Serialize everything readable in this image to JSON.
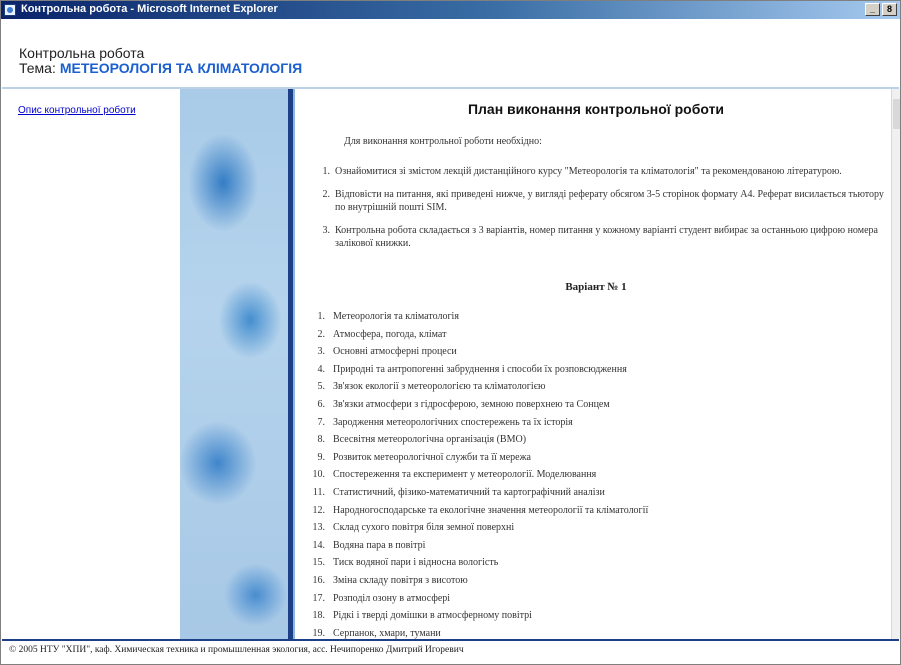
{
  "window": {
    "title": "Контрольна робота - Microsoft Internet Explorer",
    "controls": [
      "_",
      "8"
    ]
  },
  "header": {
    "line1": "Контрольна робота",
    "topic_label": "Тема:",
    "topic": "МЕТЕОРОЛОГІЯ ТА КЛІМАТОЛОГІЯ"
  },
  "sidebar": {
    "link_label": "Опис контрольної роботи"
  },
  "main": {
    "heading": "План виконання контрольної роботи",
    "intro": "Для виконання контрольної роботи необхідно:",
    "requirements": [
      {
        "num": "1.",
        "text": "Ознайомитися зі змістом лекцій дистанційного курсу \"Метеорологія та кліматологія\" та рекомендованою літературою."
      },
      {
        "num": "2.",
        "text": "Відповісти на питання, які приведені нижче, у вигляді реферату обсягом 3-5 сторінок формату А4. Реферат висилається тьютору по внутрішній пошті SIM."
      },
      {
        "num": "3.",
        "text": "Контрольна робота складається з 3 варіантів, номер питання у кожному варіанті студент вибирає за останньою цифрою номера залікової книжки."
      }
    ],
    "variant_title": "Варіант № 1",
    "questions": [
      {
        "num": "1.",
        "text": "Метеорологія та кліматологія"
      },
      {
        "num": "2.",
        "text": "Атмосфера, погода, клімат"
      },
      {
        "num": "3.",
        "text": "Основні атмосферні процеси"
      },
      {
        "num": "4.",
        "text": "Природні та антропогенні забруднення і способи їх розповсюдження"
      },
      {
        "num": "5.",
        "text": "Зв'язок екології з метеорологією та кліматологією"
      },
      {
        "num": "6.",
        "text": "Зв'язки атмосфери з гідросферою, земною поверхнею та Сонцем"
      },
      {
        "num": "7.",
        "text": "Зародження метеорологічних спостережень та їх історія"
      },
      {
        "num": "8.",
        "text": "Всесвітня метеорологічна організація (ВМО)"
      },
      {
        "num": "9.",
        "text": "Розвиток метеорологічної служби та її мережа"
      },
      {
        "num": "10.",
        "text": "Спостереження та експеримент у метеорології. Моделювання"
      },
      {
        "num": "11.",
        "text": "Статистичний, фізико-математичний та картографічний аналізи"
      },
      {
        "num": "12.",
        "text": "Народногосподарське та екологічне значення метеорології та кліматології"
      },
      {
        "num": "13.",
        "text": "Склад сухого повітря біля земної поверхні"
      },
      {
        "num": "14.",
        "text": "Водяна пара в повітрі"
      },
      {
        "num": "15.",
        "text": "Тиск водяної пари і відносна вологість"
      },
      {
        "num": "16.",
        "text": "Зміна складу повітря з висотою"
      },
      {
        "num": "17.",
        "text": "Розподіл озону в атмосфері"
      },
      {
        "num": "18.",
        "text": "Рідкі і тверді домішки в атмосферному повітрі"
      },
      {
        "num": "19.",
        "text": "Серпанок, хмари, тумани"
      }
    ]
  },
  "footer": {
    "text": "© 2005 НТУ \"ХПИ\", каф. Химическая техника и промышленная экология, асс. Нечипоренко Дмитрий Игоревич"
  }
}
